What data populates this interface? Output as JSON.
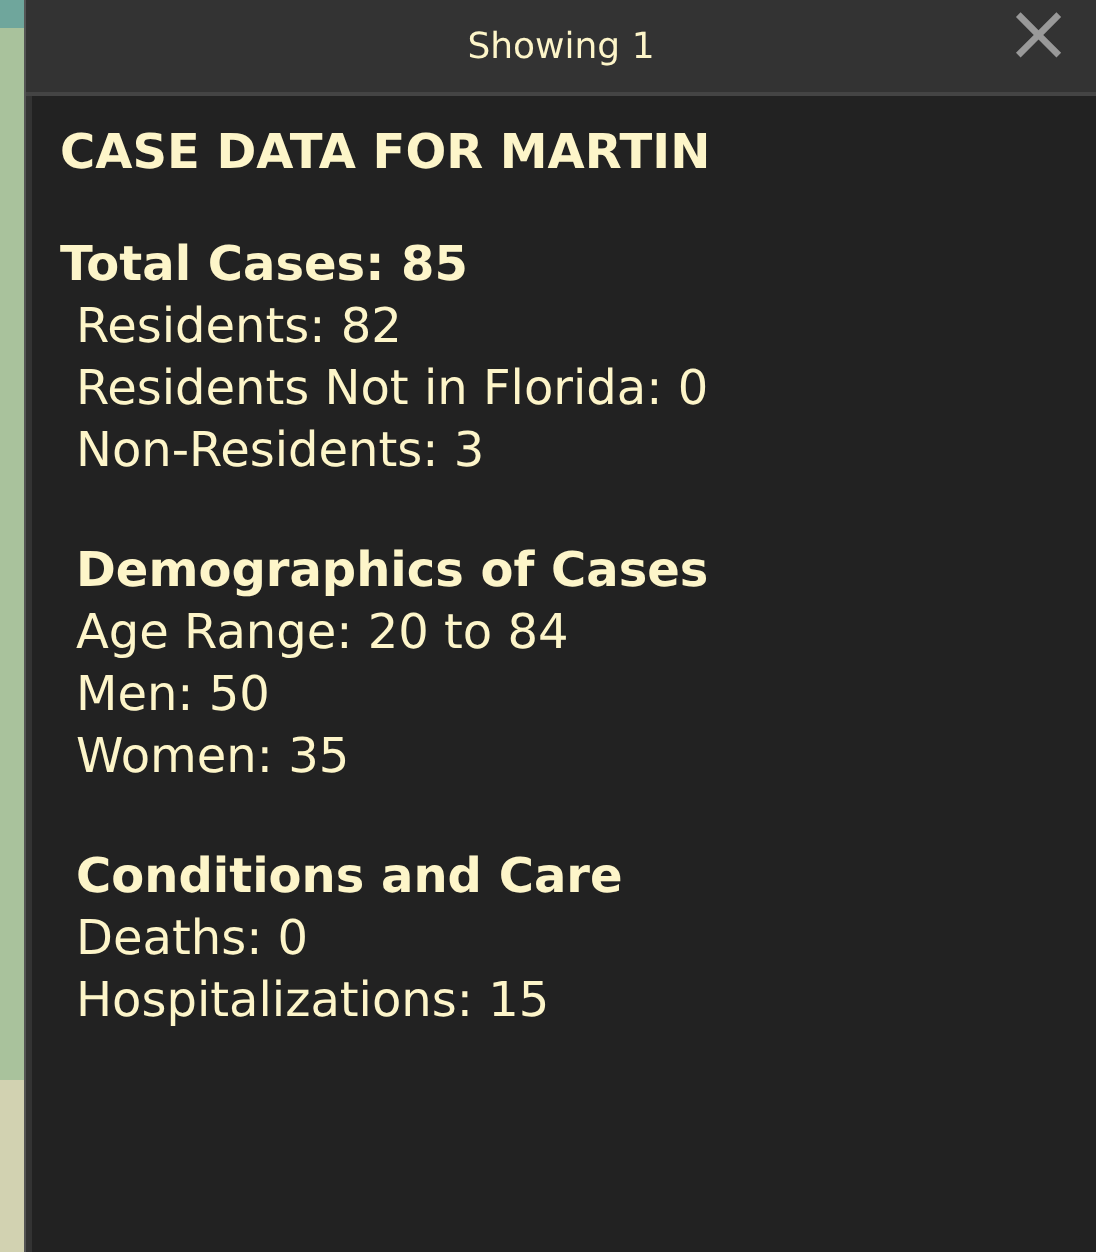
{
  "popup": {
    "header": "Showing 1",
    "close": "×"
  },
  "title": "CASE DATA FOR MARTIN",
  "sections": [
    {
      "kind": "summary",
      "heading": "Total Cases: 85",
      "lines": [
        "Residents: 82",
        "Residents Not in Florida: 0",
        "Non-Residents: 3"
      ]
    },
    {
      "kind": "group",
      "heading": "Demographics of Cases",
      "lines": [
        "Age Range: 20 to 84",
        "Men: 50",
        "Women: 35"
      ]
    },
    {
      "kind": "group",
      "heading": "Conditions and Care",
      "lines": [
        "Deaths: 0",
        "Hospitalizations: 15"
      ]
    }
  ]
}
